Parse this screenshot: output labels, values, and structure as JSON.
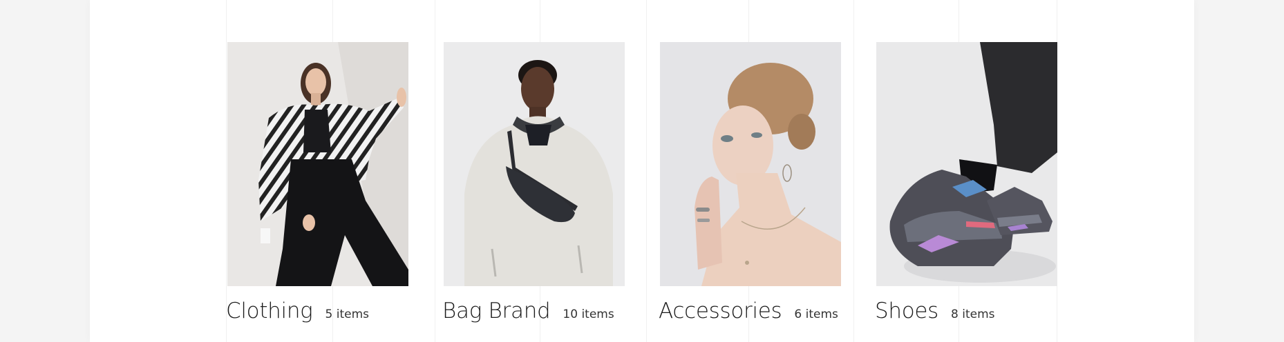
{
  "categories": [
    {
      "title": "Clothing",
      "count": "5 items",
      "image": "woman-in-zebra-print-jacket-photo"
    },
    {
      "title": "Bag Brand",
      "count": "10 items",
      "image": "man-with-crossbody-bag-photo"
    },
    {
      "title": "Accessories",
      "count": "6 items",
      "image": "woman-with-rings-and-necklace-photo"
    },
    {
      "title": "Shoes",
      "count": "8 items",
      "image": "chunky-sneakers-photo"
    }
  ],
  "colors": {
    "background": "#ffffff",
    "outer_background": "#f4f4f4",
    "title_text": "#1b1b1b",
    "count_text": "#333333"
  }
}
